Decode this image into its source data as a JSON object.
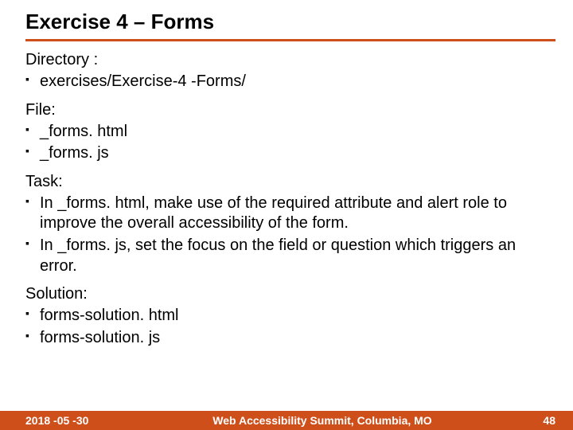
{
  "title": "Exercise 4 – Forms",
  "sections": {
    "directory": {
      "label": "Directory :",
      "items": [
        "exercises/Exercise-4 -Forms/"
      ]
    },
    "file": {
      "label": "File:",
      "items": [
        "_forms. html",
        "_forms. js"
      ]
    },
    "task": {
      "label": "Task:",
      "items": [
        "In _forms. html, make use of the required attribute and alert role to improve the overall accessibility of the form.",
        "In _forms. js, set the focus on the field or question which triggers an error."
      ]
    },
    "solution": {
      "label": "Solution:",
      "items": [
        "forms-solution. html",
        "forms-solution. js"
      ]
    }
  },
  "footer": {
    "date": "2018 -05 -30",
    "venue": "Web Accessibility Summit, Columbia, MO",
    "page": "48"
  }
}
